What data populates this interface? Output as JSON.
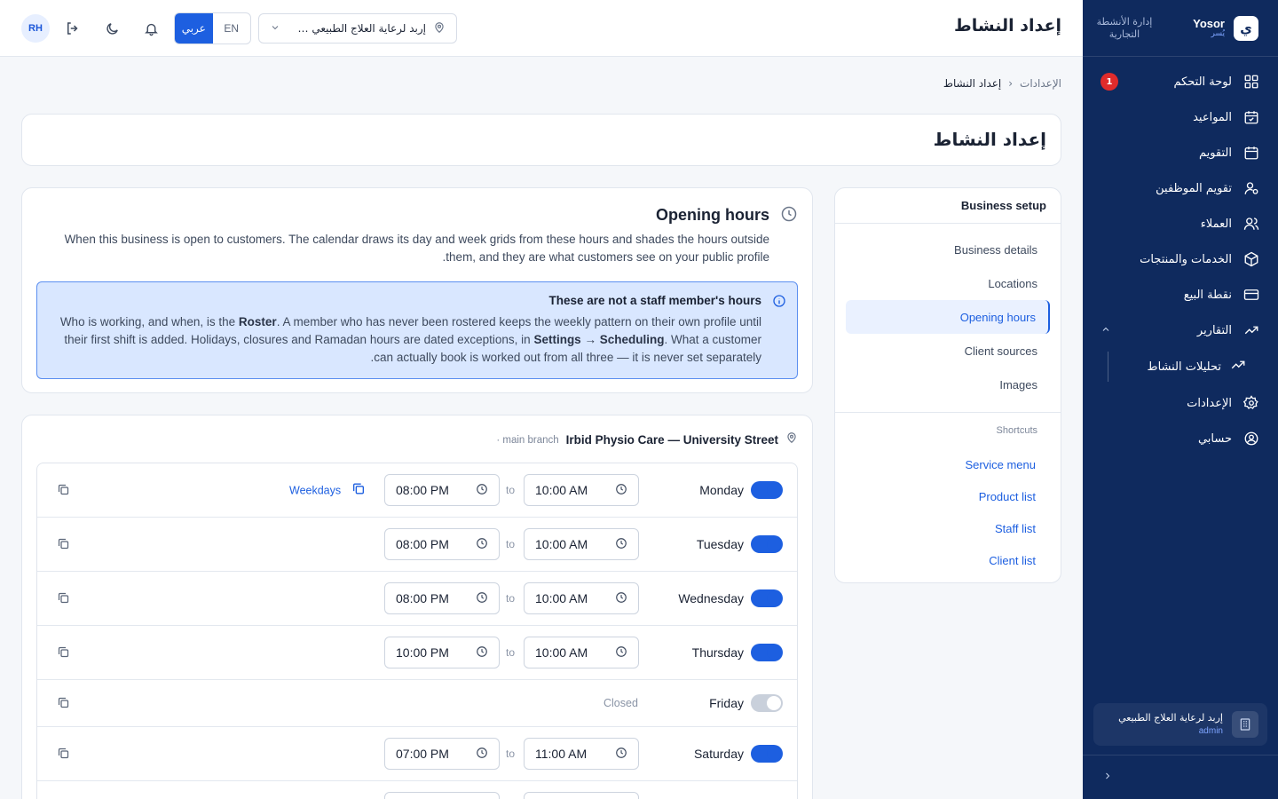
{
  "brand": {
    "name": "Yosor",
    "sub": "يُسر",
    "tag": "إدارة الأنشطة التجارية",
    "logo": "ي"
  },
  "header": {
    "title": "إعداد النشاط",
    "avatar": "RH",
    "lang_ar": "عربي",
    "lang_en": "EN",
    "location": "إربد لرعاية العلاج الطبيعي — ..."
  },
  "sidebar": {
    "items": [
      {
        "label": "لوحة التحكم",
        "icon": "dashboard-icon",
        "badge": "1"
      },
      {
        "label": "المواعيد",
        "icon": "appointments-icon"
      },
      {
        "label": "التقويم",
        "icon": "calendar-icon"
      },
      {
        "label": "تقويم الموظفين",
        "icon": "staff-calendar-icon"
      },
      {
        "label": "العملاء",
        "icon": "clients-icon"
      },
      {
        "label": "الخدمات والمنتجات",
        "icon": "box-icon"
      },
      {
        "label": "نقطة البيع",
        "icon": "card-icon"
      },
      {
        "label": "التقارير",
        "icon": "trend-icon"
      },
      {
        "label": "تحليلات النشاط",
        "icon": "trend-icon"
      },
      {
        "label": "الإعدادات",
        "icon": "gear-icon"
      },
      {
        "label": "حسابي",
        "icon": "user-circle-icon"
      }
    ],
    "footer": {
      "business": "إربد لرعاية العلاج الطبيعي",
      "role": "admin"
    }
  },
  "breadcrumb": {
    "parent": "الإعدادات",
    "current": "إعداد النشاط"
  },
  "page_title": "إعداد النشاط",
  "setup": {
    "title": "Business setup",
    "items": [
      "Business details",
      "Locations",
      "Opening hours",
      "Client sources",
      "Images"
    ],
    "active": "Opening hours",
    "shortcuts_title": "Shortcuts",
    "shortcuts": [
      "Service menu",
      "Product list",
      "Staff list",
      "Client list"
    ]
  },
  "hours": {
    "title": "Opening hours",
    "desc": "When this business is open to customers. The calendar draws its day and week grids from these hours and shades the hours outside them, and they are what customers see on your public profile.",
    "notice_title": "These are not a staff member's hours",
    "notice_p1": "Who is working, and when, is the ",
    "notice_b1": "Roster",
    "notice_p2": ". A member who has never been rostered keeps the weekly pattern on their own profile until their first shift is added. Holidays, closures and Ramadan hours are dated exceptions, in ",
    "notice_b2": "Settings → Scheduling",
    "notice_p3": ". What a customer can actually book is worked out from all three — it is never set separately."
  },
  "schedule": {
    "branch_name": "Irbid Physio Care — University Street",
    "branch_tag": "main branch ·",
    "to_label": "to",
    "weekdays_label": "Weekdays",
    "closed_label": "Closed",
    "days": [
      {
        "day": "Monday",
        "open": true,
        "from": "10:00 AM",
        "to": "08:00 PM"
      },
      {
        "day": "Tuesday",
        "open": true,
        "from": "10:00 AM",
        "to": "08:00 PM"
      },
      {
        "day": "Wednesday",
        "open": true,
        "from": "10:00 AM",
        "to": "08:00 PM"
      },
      {
        "day": "Thursday",
        "open": true,
        "from": "10:00 AM",
        "to": "10:00 PM"
      },
      {
        "day": "Friday",
        "open": false
      },
      {
        "day": "Saturday",
        "open": true,
        "from": "11:00 AM",
        "to": "07:00 PM"
      }
    ]
  },
  "colors": {
    "sidebar": "#0f2a5e",
    "accent": "#1d5fe0",
    "badge": "#e02b2b",
    "notice_bg": "#d9e7ff"
  }
}
